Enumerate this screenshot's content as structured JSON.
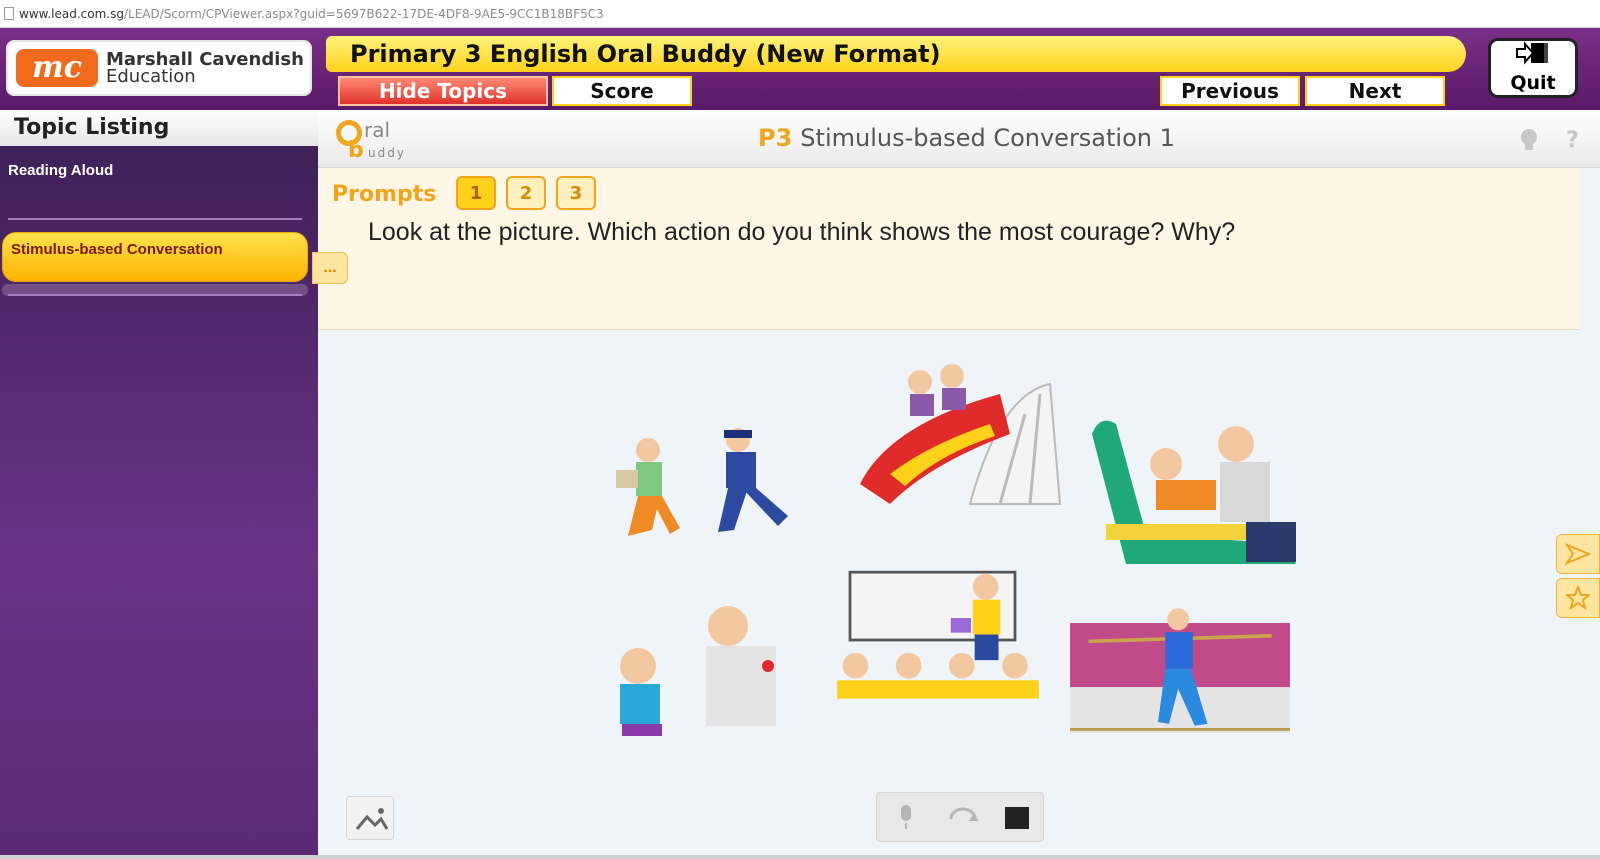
{
  "browser": {
    "url_host": "www.lead.com.sg",
    "url_path": "/LEAD/Scorm/CPViewer.aspx?guid=5697B622-17DE-4DF8-9AE5-9CC1B18BF5C3"
  },
  "header": {
    "logo_mark": "mc",
    "logo_line1": "Marshall Cavendish",
    "logo_line2": "Education",
    "title": "Primary 3 English Oral Buddy (New Format)",
    "hide_topics": "Hide Topics",
    "score": "Score",
    "previous": "Previous",
    "next": "Next",
    "quit": "Quit"
  },
  "sidebar": {
    "heading": "Topic Listing",
    "items": [
      {
        "label": "Reading Aloud"
      },
      {
        "label": "Stimulus-based Conversation"
      }
    ]
  },
  "main": {
    "brand_o": "O",
    "brand_ral": "ral",
    "brand_b": "b",
    "brand_uddy": "uddy",
    "title_prefix": "P3",
    "title": "Stimulus-based Conversation 1",
    "hint_icon": "lightbulb-icon",
    "help_icon": "?",
    "prompts_label": "Prompts",
    "prompts": [
      "1",
      "2",
      "3"
    ],
    "active_prompt": "1",
    "question": "Look at the picture. Which action do you think shows the most courage? Why?",
    "more": "..."
  },
  "colors": {
    "header_purple": "#6a2a78",
    "title_yellow": "#ffd21a",
    "accent_orange": "#f0a51c",
    "brand_orange": "#f26a1b"
  }
}
